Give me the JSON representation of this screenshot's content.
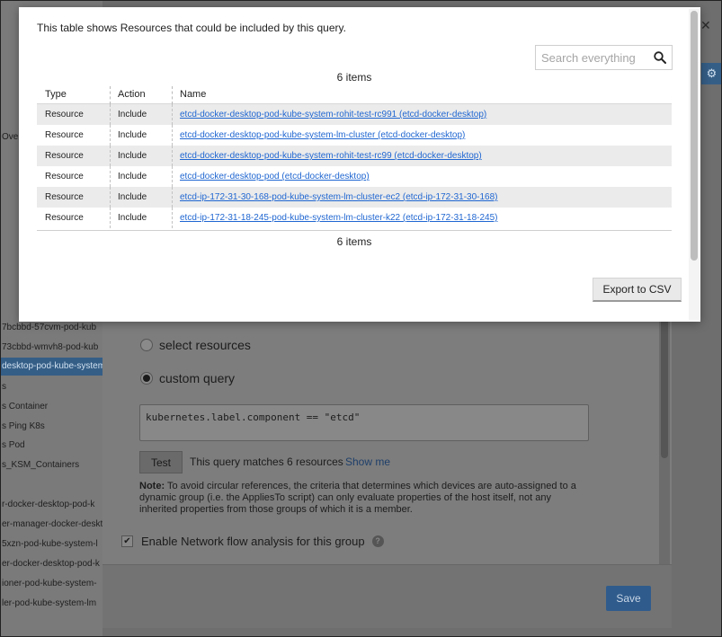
{
  "modal": {
    "description": "This table shows Resources that could be included by this query.",
    "search_placeholder": "Search everything",
    "count_label": "6 items",
    "columns": [
      "Type",
      "Action",
      "Name"
    ],
    "rows": [
      {
        "type": "Resource",
        "action": "Include",
        "name": "etcd-docker-desktop-pod-kube-system-rohit-test-rc991 (etcd-docker-desktop)"
      },
      {
        "type": "Resource",
        "action": "Include",
        "name": "etcd-docker-desktop-pod-kube-system-lm-cluster (etcd-docker-desktop)"
      },
      {
        "type": "Resource",
        "action": "Include",
        "name": "etcd-docker-desktop-pod-kube-system-rohit-test-rc99 (etcd-docker-desktop)"
      },
      {
        "type": "Resource",
        "action": "Include",
        "name": "etcd-docker-desktop-pod (etcd-docker-desktop)"
      },
      {
        "type": "Resource",
        "action": "Include",
        "name": "etcd-ip-172-31-30-168-pod-kube-system-lm-cluster-ec2 (etcd-ip-172-31-30-168)"
      },
      {
        "type": "Resource",
        "action": "Include",
        "name": "etcd-ip-172-31-18-245-pod-kube-system-lm-cluster-k22 (etcd-ip-172-31-18-245)"
      }
    ],
    "export_label": "Export to CSV"
  },
  "background": {
    "sidebar_items": [
      "Ove",
      "7bcbbd-57cvm-pod-kub",
      "73cbbd-wmvh8-pod-kub",
      "desktop-pod-kube-system",
      "s",
      "s Container",
      "s Ping K8s",
      "s Pod",
      "s_KSM_Containers",
      "r-docker-desktop-pod-k",
      "er-manager-docker-deskt",
      "5xzn-pod-kube-system-l",
      "er-docker-desktop-pod-k",
      "ioner-pod-kube-system-",
      "ler-pod-kube-system-lm"
    ],
    "radio_select_label": "select resources",
    "radio_custom_label": "custom query",
    "query_text": "kubernetes.label.component == \"etcd\"",
    "test_label": "Test",
    "match_text": "This query matches 6 resources",
    "show_me_label": "Show me",
    "note_bold": "Note:",
    "note_text": " To avoid circular references, the criteria that determines which devices are auto-assigned to a dynamic group (i.e. the AppliesTo script) can only evaluate properties of the host itself, not any inherited properties from those groups of which it is a member.",
    "netflow_label": "Enable Network flow analysis for this group",
    "save_label": "Save"
  }
}
